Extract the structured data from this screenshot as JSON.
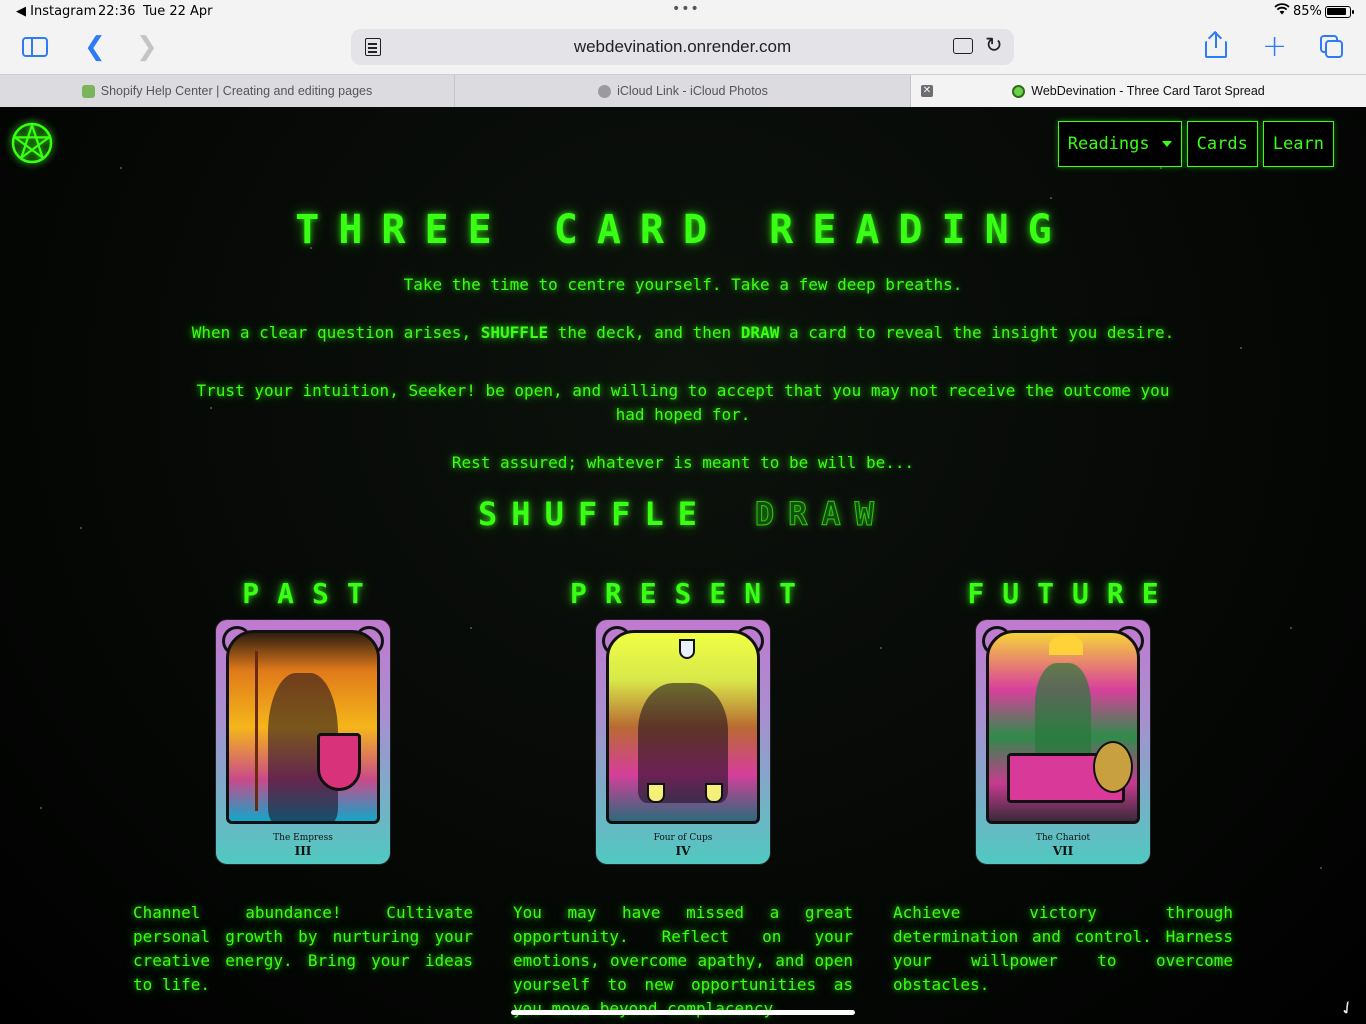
{
  "status_bar": {
    "back_app": "◀ Instagram",
    "time": "22:36",
    "date": "Tue 22 Apr",
    "battery": "85%"
  },
  "browser": {
    "url": "webdevination.onrender.com",
    "tabs": [
      {
        "title": "Shopify Help Center | Creating and editing pages",
        "icon": "shopify-favicon"
      },
      {
        "title": "iCloud Link - iCloud Photos",
        "icon": "apple-favicon"
      },
      {
        "title": "WebDevination - Three Card Tarot Spread",
        "icon": "webdevination-favicon",
        "active": true
      }
    ]
  },
  "nav": {
    "readings": "Readings",
    "cards": "Cards",
    "learn": "Learn"
  },
  "page": {
    "title": "THREE CARD READING",
    "intro_1": "Take the time to centre yourself. Take a few deep breaths.",
    "intro_2_a": "When a clear question arises, ",
    "intro_2_shuffle": "SHUFFLE",
    "intro_2_b": " the deck, and then ",
    "intro_2_draw": "DRAW",
    "intro_2_c": " a card to reveal the insight you desire.",
    "intro_3": "Trust your intuition, Seeker! be open, and willing to accept that you may not receive the outcome you had hoped for.",
    "intro_4": "Rest assured; whatever is meant to be will be...",
    "shuffle_button": "SHUFFLE",
    "draw_button": "DRAW"
  },
  "spread": [
    {
      "position": "PAST",
      "card_name": "The Empress",
      "card_number": "III",
      "description": "Channel abundance! Cultivate personal growth by nurturing your creative energy. Bring your ideas to life."
    },
    {
      "position": "PRESENT",
      "card_name": "Four of Cups",
      "card_number": "IV",
      "description": "You may have missed a great opportunity. Reflect on your emotions, overcome apathy, and open yourself to new opportunities as you move beyond complacency."
    },
    {
      "position": "FUTURE",
      "card_name": "The Chariot",
      "card_number": "VII",
      "description": "Achieve victory through determination and control. Harness your willpower to overcome obstacles."
    }
  ],
  "colors": {
    "neon_green": "#39ff14",
    "background": "#000000",
    "safari_blue": "#2f7bf5"
  }
}
